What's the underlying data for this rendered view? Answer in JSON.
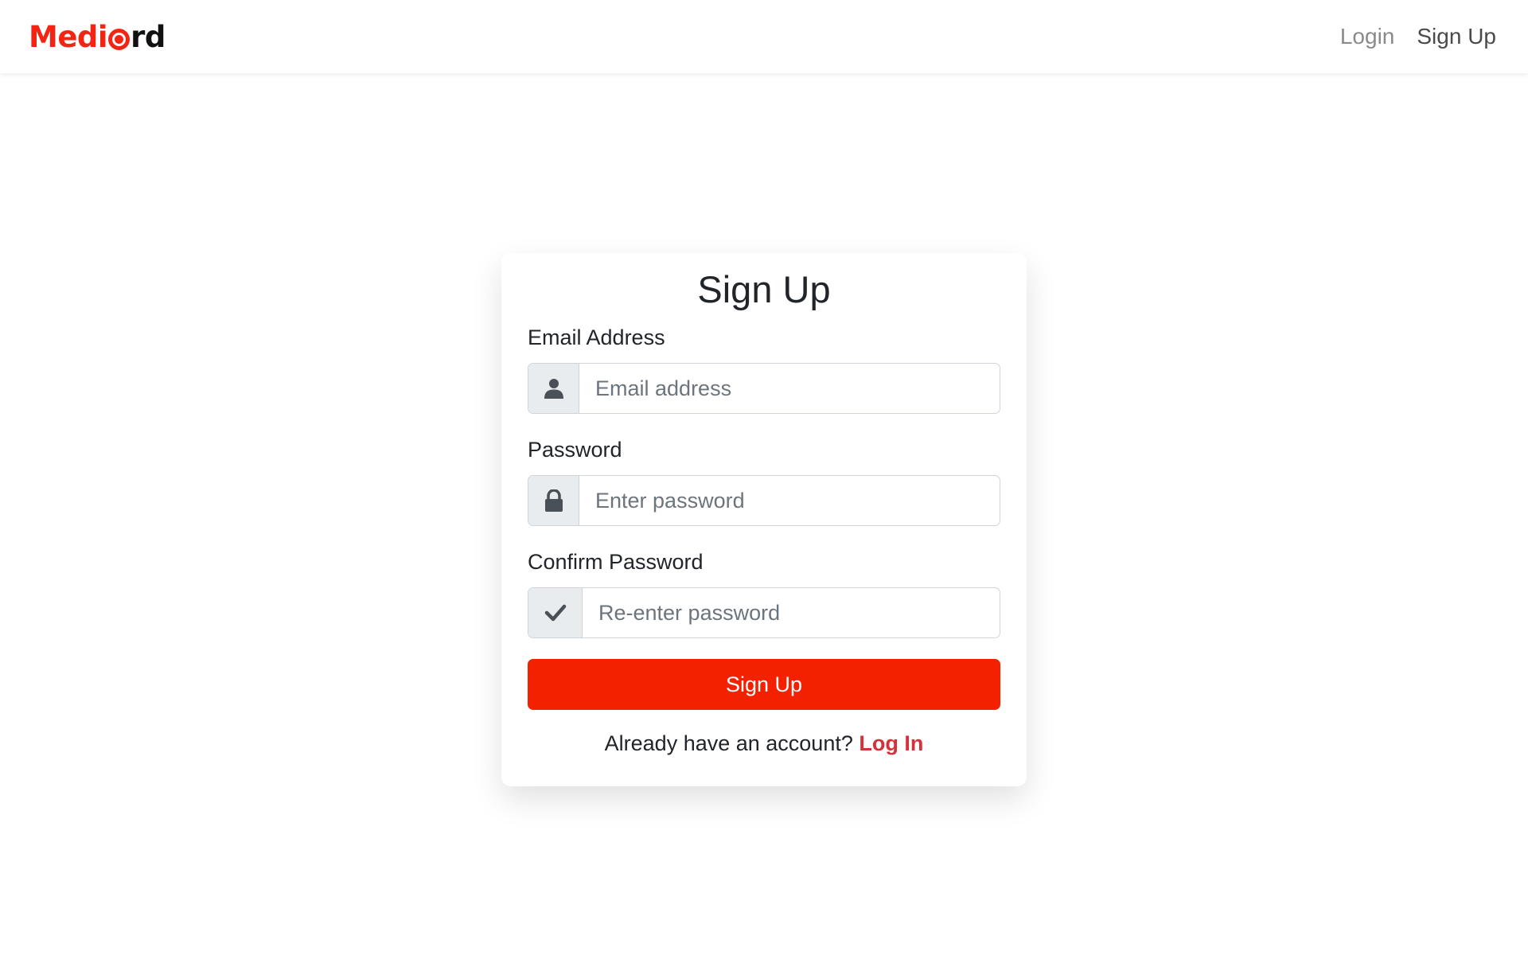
{
  "navbar": {
    "brand": {
      "part1": "Medi",
      "part2_letter": "C",
      "part3": "rd",
      "accent_color": "#f42414"
    },
    "links": {
      "login": "Login",
      "signup": "Sign Up"
    }
  },
  "form": {
    "title": "Sign Up",
    "email": {
      "label": "Email Address",
      "placeholder": "Email address",
      "value": "",
      "icon": "user-icon"
    },
    "password": {
      "label": "Password",
      "placeholder": "Enter password",
      "value": "",
      "icon": "lock-icon"
    },
    "confirm_password": {
      "label": "Confirm Password",
      "placeholder": "Re-enter password",
      "value": "",
      "icon": "check-icon"
    },
    "submit_label": "Sign Up",
    "submit_color": "#f42100",
    "footer": {
      "prompt": "Already have an account?",
      "link": "Log In",
      "link_color": "#d63038"
    }
  }
}
